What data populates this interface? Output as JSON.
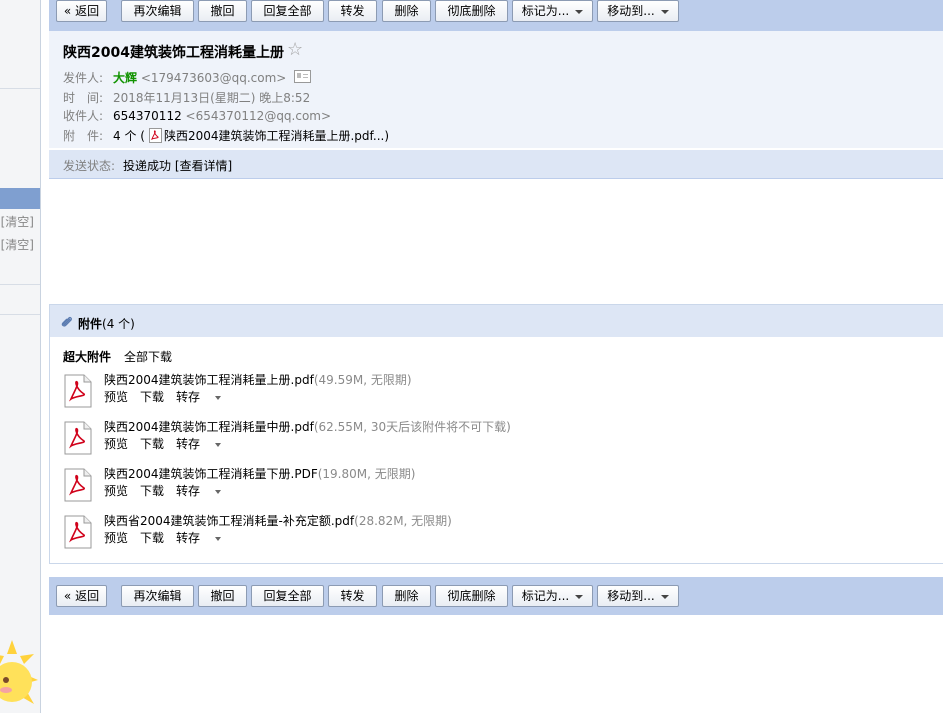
{
  "toolbar": {
    "buttons": [
      "« 返回",
      "再次编辑",
      "撤回",
      "回复全部",
      "转发",
      "删除",
      "彻底删除",
      "标记为...",
      "移动到..."
    ]
  },
  "sidebar": {
    "clear_1": "[清空]",
    "clear_2": "[清空]"
  },
  "mail": {
    "subject": "陕西2004建筑装饰工程消耗量上册",
    "star": "☆",
    "from_label": "发件人:",
    "from_name": "大辉",
    "from_email": "<179473603@qq.com>",
    "time_label": "时　间:",
    "time_value": "2018年11月13日(星期二) 晚上8:52",
    "to_label": "收件人:",
    "to_name": "654370112",
    "to_email": "<654370112@qq.com>",
    "att_label": "附　件:",
    "att_count": "4 个 (",
    "att_first": "陕西2004建筑装饰工程消耗量上册.pdf...)",
    "status_label": "发送状态:",
    "status_value": "投递成功",
    "status_link": "[查看详情]"
  },
  "attachments": {
    "title_bold": "附件",
    "title_count": "(4 个)",
    "big_label": "超大附件",
    "download_all": "全部下载",
    "actions": {
      "preview": "预览",
      "download": "下载",
      "save": "转存"
    },
    "items": [
      {
        "name": "陕西2004建筑装饰工程消耗量上册.pdf",
        "meta": "(49.59M, 无限期)"
      },
      {
        "name": "陕西2004建筑装饰工程消耗量中册.pdf",
        "meta": "(62.55M, 30天后该附件将不可下载)"
      },
      {
        "name": "陕西2004建筑装饰工程消耗量下册.PDF",
        "meta": "(19.80M, 无限期)"
      },
      {
        "name": "陕西省2004建筑装饰工程消耗量-补充定额.pdf",
        "meta": "(28.82M, 无限期)"
      }
    ]
  },
  "colors": {
    "toolbar_bg": "#bccdeb",
    "header_bg": "#eff3fa",
    "sender_green": "#119300"
  }
}
